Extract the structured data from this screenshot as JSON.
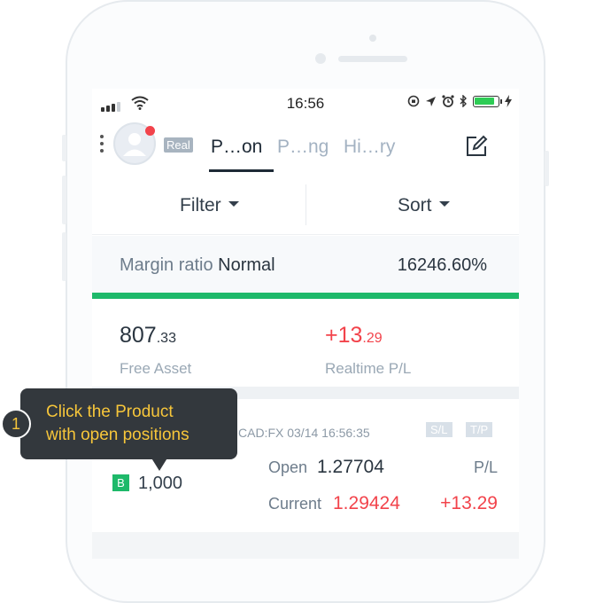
{
  "status_bar": {
    "time": "16:56"
  },
  "header": {
    "badge": "Real",
    "tabs": [
      {
        "label": "P…on"
      },
      {
        "label": "P…ng"
      },
      {
        "label": "Hi…ry"
      }
    ]
  },
  "filter_sort": {
    "filter_label": "Filter",
    "sort_label": "Sort"
  },
  "margin": {
    "label": "Margin ratio",
    "status": "Normal",
    "value": "16246.60%"
  },
  "assets": {
    "free_asset_int": "807",
    "free_asset_dec": ".33",
    "free_asset_label": "Free Asset",
    "realtime_pl_int": "+13",
    "realtime_pl_dec": ".29",
    "realtime_pl_label": "Realtime P/L"
  },
  "position": {
    "product": "CAD:FX 03/14 16:56:35",
    "sl_tag": "S/L",
    "tp_tag": "T/P",
    "side": "B",
    "quantity": "1,000",
    "open_label": "Open",
    "open_value": "1.27704",
    "current_label": "Current",
    "current_value": "1.29424",
    "pl_label": "P/L",
    "pl_value": "+13.29"
  },
  "tooltip": {
    "step": "1",
    "line1": "Click the Product",
    "line2": "with open positions"
  },
  "colors": {
    "accent_green": "#1eb96a",
    "loss_profit_red": "#f2434b",
    "tooltip_bg": "#33383d",
    "tooltip_text": "#f7c63a"
  }
}
